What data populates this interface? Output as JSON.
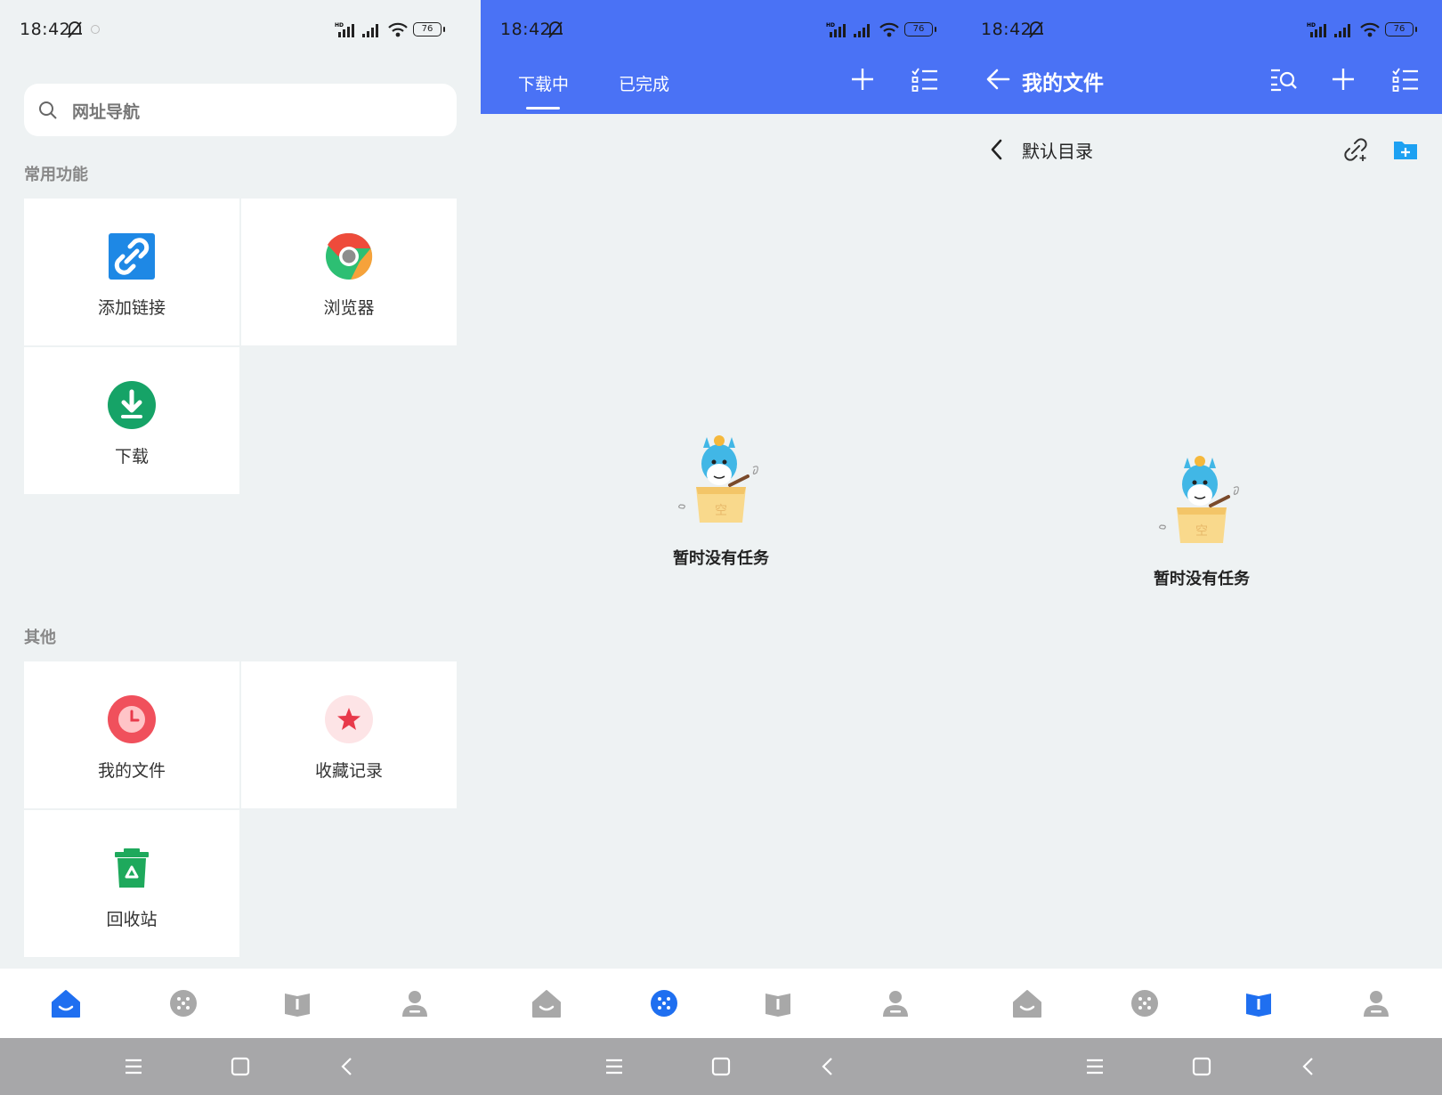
{
  "status_bar": {
    "time": "18:42",
    "battery": "76"
  },
  "colors": {
    "accent": "#4a72f5",
    "active_nav": "#1f6ff0",
    "inactive_nav": "#a8a8a8",
    "green": "#1aa260",
    "red": "#ff4d5a"
  },
  "panel1": {
    "search_placeholder": "网址导航",
    "section_common": "常用功能",
    "common_items": [
      {
        "label": "添加链接",
        "icon": "link-icon"
      },
      {
        "label": "浏览器",
        "icon": "browser-icon"
      },
      {
        "label": "下载",
        "icon": "download-icon"
      }
    ],
    "section_other": "其他",
    "other_items": [
      {
        "label": "我的文件",
        "icon": "clock-icon"
      },
      {
        "label": "收藏记录",
        "icon": "star-icon"
      },
      {
        "label": "回收站",
        "icon": "recycle-bin-icon"
      }
    ]
  },
  "panel2": {
    "tabs": [
      {
        "label": "下载中",
        "active": true
      },
      {
        "label": "已完成",
        "active": false
      }
    ],
    "empty_text": "暂时没有任务"
  },
  "panel3": {
    "title": "我的文件",
    "breadcrumb": "默认目录",
    "empty_text": "暂时没有任务"
  },
  "bottom_nav": [
    "home-icon",
    "discover-icon",
    "book-icon",
    "profile-icon"
  ],
  "system_nav": [
    "menu-icon",
    "home-square-icon",
    "back-icon"
  ]
}
